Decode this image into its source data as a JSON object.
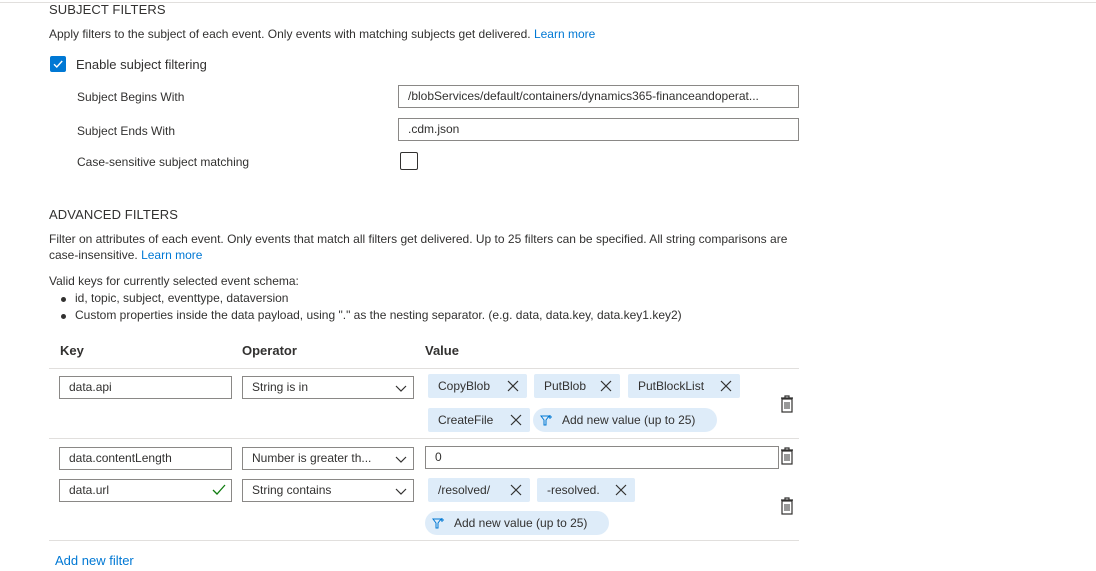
{
  "subject_filters": {
    "title": "SUBJECT FILTERS",
    "description": "Apply filters to the subject of each event. Only events with matching subjects get delivered.",
    "learn_more": "Learn more",
    "enable_label": "Enable subject filtering",
    "enable_checked": true,
    "begins_with_label": "Subject Begins With",
    "begins_with_value": "/blobServices/default/containers/dynamics365-financeandoperat...",
    "ends_with_label": "Subject Ends With",
    "ends_with_value": ".cdm.json",
    "case_sensitive_label": "Case-sensitive subject matching",
    "case_sensitive_checked": false
  },
  "advanced_filters": {
    "title": "ADVANCED FILTERS",
    "description": "Filter on attributes of each event. Only events that match all filters get delivered. Up to 25 filters can be specified. All string comparisons are case-insensitive.",
    "description_line1": "Filter on attributes of each event. Only events that match all filters get delivered. Up to 25 filters can be specified. All string comparisons are",
    "description_line2": "case-insensitive.",
    "learn_more": "Learn more",
    "valid_keys_intro": "Valid keys for currently selected event schema:",
    "valid_keys": [
      "id, topic, subject, eventtype, dataversion",
      "Custom properties inside the data payload, using \".\" as the nesting separator. (e.g. data, data.key, data.key1.key2)"
    ],
    "columns": {
      "key": "Key",
      "operator": "Operator",
      "value": "Value"
    },
    "filters": [
      {
        "key": "data.api",
        "operator": "String is in",
        "values": [
          "CopyBlob",
          "PutBlob",
          "PutBlockList",
          "CreateFile"
        ],
        "add_value": "Add new value (up to 25)"
      },
      {
        "key": "data.contentLength",
        "operator": "Number is greater th...",
        "value": "0"
      },
      {
        "key": "data.url",
        "key_valid": true,
        "operator": "String contains",
        "values": [
          "/resolved/",
          "-resolved."
        ],
        "add_value": "Add new value (up to 25)"
      }
    ],
    "add_filter": "Add new filter"
  },
  "colors": {
    "accent": "#0078d4",
    "chip_bg": "#deecf9",
    "border": "#8a8886",
    "divider": "#e1dfdd",
    "valid_check": "#107c10"
  }
}
